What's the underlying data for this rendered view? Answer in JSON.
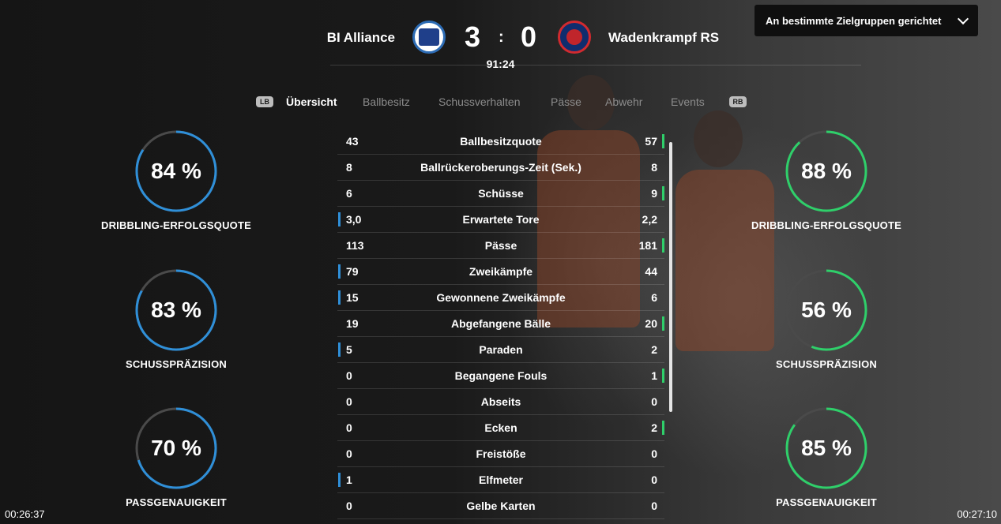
{
  "header": {
    "home_team": "BI Alliance",
    "away_team": "Wadenkrampf RS",
    "home_score": "3",
    "away_score": "0",
    "separator": ":",
    "clock": "91:24"
  },
  "audience_dropdown": {
    "label": "An bestimmte Zielgruppen gerichtet",
    "icon": "chevron-down-icon"
  },
  "tabs": {
    "left_bumper": "LB",
    "right_bumper": "RB",
    "items": [
      {
        "label": "Übersicht",
        "active": true
      },
      {
        "label": "Ballbesitz",
        "active": false
      },
      {
        "label": "Schussverhalten",
        "active": false
      },
      {
        "label": "Pässe",
        "active": false
      },
      {
        "label": "Abwehr",
        "active": false
      },
      {
        "label": "Events",
        "active": false
      }
    ]
  },
  "home_gauges": [
    {
      "value": 84,
      "text": "84 %",
      "label": "DRIBBLING-ERFOLGSQUOTE"
    },
    {
      "value": 83,
      "text": "83 %",
      "label": "SCHUSSPRÄZISION"
    },
    {
      "value": 70,
      "text": "70 %",
      "label": "PASSGENAUIGKEIT"
    }
  ],
  "away_gauges": [
    {
      "value": 88,
      "text": "88 %",
      "label": "DRIBBLING-ERFOLGSQUOTE"
    },
    {
      "value": 56,
      "text": "56 %",
      "label": "SCHUSSPRÄZISION"
    },
    {
      "value": 85,
      "text": "85 %",
      "label": "PASSGENAUIGKEIT"
    }
  ],
  "colors": {
    "home_accent": "#2f8fd8",
    "away_accent": "#2fcf6a",
    "track": "#4a4a4a"
  },
  "stats": [
    {
      "label": "Ballbesitzquote",
      "home": "43",
      "away": "57",
      "leader": "away"
    },
    {
      "label": "Ballrückeroberungs-Zeit (Sek.)",
      "home": "8",
      "away": "8",
      "leader": "none"
    },
    {
      "label": "Schüsse",
      "home": "6",
      "away": "9",
      "leader": "away"
    },
    {
      "label": "Erwartete Tore",
      "home": "3,0",
      "away": "2,2",
      "leader": "home"
    },
    {
      "label": "Pässe",
      "home": "113",
      "away": "181",
      "leader": "away"
    },
    {
      "label": "Zweikämpfe",
      "home": "79",
      "away": "44",
      "leader": "home"
    },
    {
      "label": "Gewonnene Zweikämpfe",
      "home": "15",
      "away": "6",
      "leader": "home"
    },
    {
      "label": "Abgefangene Bälle",
      "home": "19",
      "away": "20",
      "leader": "away"
    },
    {
      "label": "Paraden",
      "home": "5",
      "away": "2",
      "leader": "home"
    },
    {
      "label": "Begangene Fouls",
      "home": "0",
      "away": "1",
      "leader": "away"
    },
    {
      "label": "Abseits",
      "home": "0",
      "away": "0",
      "leader": "none"
    },
    {
      "label": "Ecken",
      "home": "0",
      "away": "2",
      "leader": "away"
    },
    {
      "label": "Freistöße",
      "home": "0",
      "away": "0",
      "leader": "none"
    },
    {
      "label": "Elfmeter",
      "home": "1",
      "away": "0",
      "leader": "home"
    },
    {
      "label": "Gelbe Karten",
      "home": "0",
      "away": "0",
      "leader": "none"
    }
  ],
  "video": {
    "elapsed": "00:26:37",
    "total": "00:27:10"
  }
}
